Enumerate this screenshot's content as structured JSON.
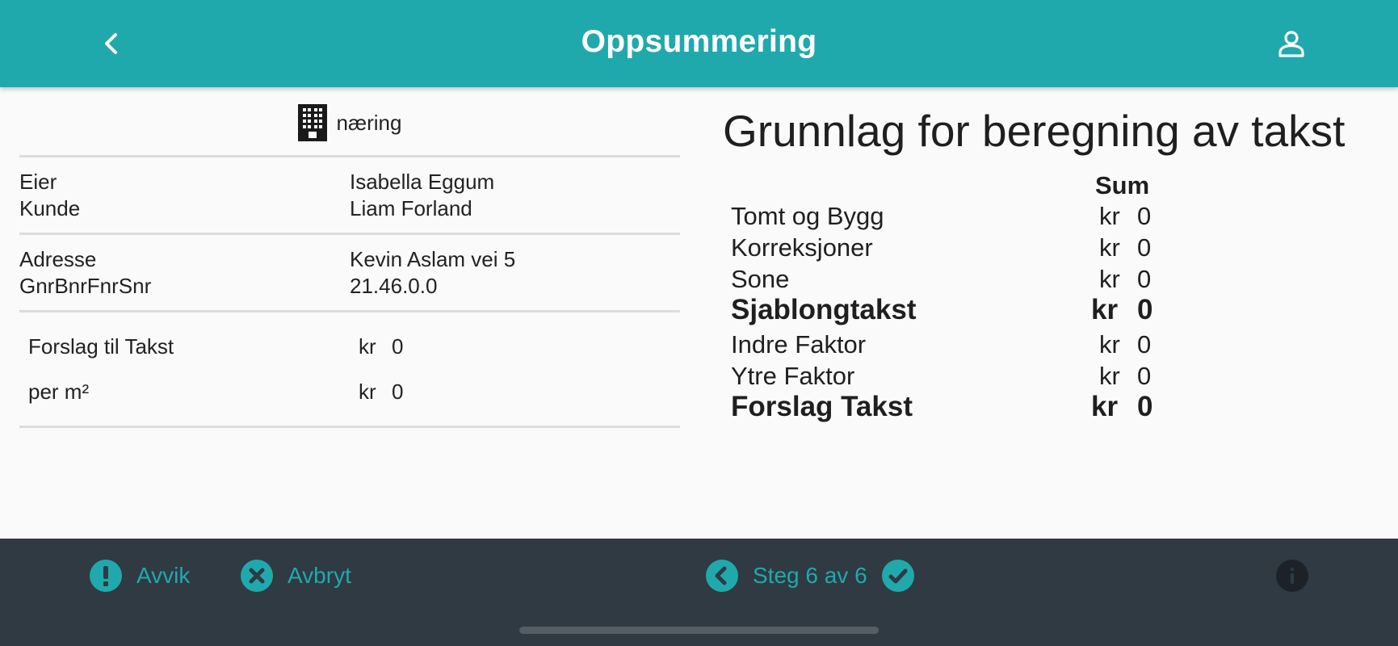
{
  "header": {
    "title": "Oppsummering",
    "back_icon": "chevron-left-icon",
    "account_icon": "account-icon"
  },
  "property": {
    "type_label": "næring",
    "type_icon": "building-icon",
    "owner_label": "Eier",
    "owner_value": "Isabella Eggum",
    "customer_label": "Kunde",
    "customer_value": "Liam Forland",
    "address_label": "Adresse",
    "address_value": "Kevin Aslam vei 5",
    "gnr_label": "GnrBnrFnrSnr",
    "gnr_value": "21.46.0.0",
    "proposal_label": "Forslag til Takst",
    "proposal_currency": "kr",
    "proposal_value": "0",
    "per_m2_label": "per m²",
    "per_m2_currency": "kr",
    "per_m2_value": "0"
  },
  "calculation": {
    "title": "Grunnlag for beregning av takst",
    "sum_header": "Sum",
    "rows": [
      {
        "label": "Tomt og Bygg",
        "currency": "kr",
        "value": "0"
      },
      {
        "label": "Korreksjoner",
        "currency": "kr",
        "value": "0"
      },
      {
        "label": "Sone",
        "currency": "kr",
        "value": "0"
      },
      {
        "label": "Sjablongtakst",
        "currency": "kr",
        "value": "0"
      },
      {
        "label": "Indre Faktor",
        "currency": "kr",
        "value": "0"
      },
      {
        "label": "Ytre Faktor",
        "currency": "kr",
        "value": "0"
      },
      {
        "label": "Forslag Takst",
        "currency": "kr",
        "value": "0"
      }
    ]
  },
  "footer": {
    "deviation_label": "Avvik",
    "cancel_label": "Avbryt",
    "step_label": "Steg 6 av 6",
    "accent_color": "#20a9ad",
    "bar_color": "#2f3a42"
  }
}
